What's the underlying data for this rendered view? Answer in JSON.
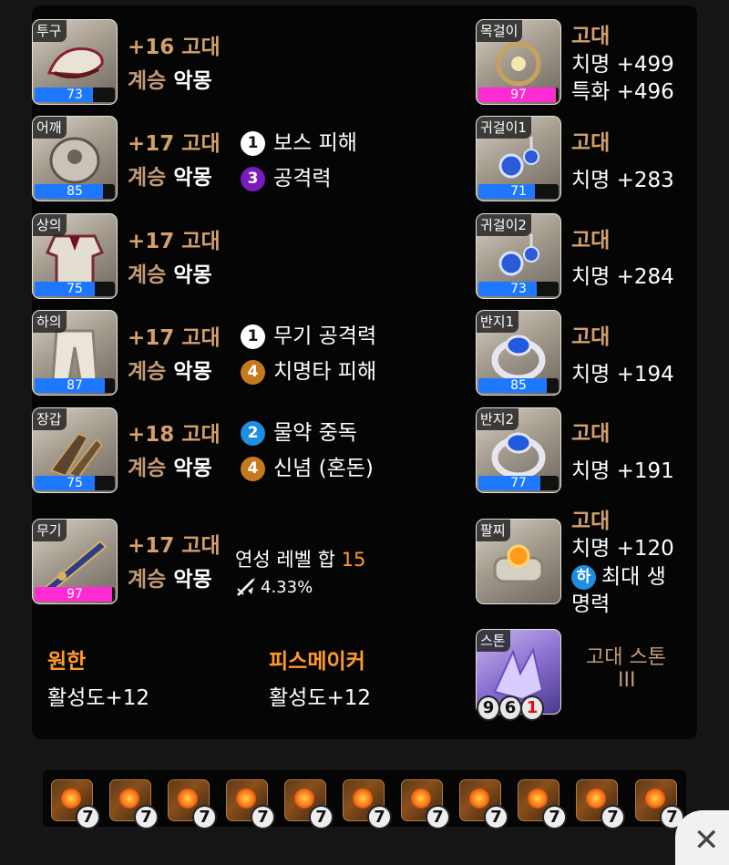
{
  "left_equipment": [
    {
      "slot": "투구",
      "quality": 73,
      "quality_color": "blue",
      "level": "+16",
      "grade": "고대",
      "succession": "계승",
      "set_name": "악몽"
    },
    {
      "slot": "어깨",
      "quality": 85,
      "quality_color": "blue",
      "level": "+17",
      "grade": "고대",
      "succession": "계승",
      "set_name": "악몽"
    },
    {
      "slot": "상의",
      "quality": 75,
      "quality_color": "blue",
      "level": "+17",
      "grade": "고대",
      "succession": "계승",
      "set_name": "악몽"
    },
    {
      "slot": "하의",
      "quality": 87,
      "quality_color": "blue",
      "level": "+17",
      "grade": "고대",
      "succession": "계승",
      "set_name": "악몽"
    },
    {
      "slot": "장갑",
      "quality": 75,
      "quality_color": "blue",
      "level": "+18",
      "grade": "고대",
      "succession": "계승",
      "set_name": "악몽"
    },
    {
      "slot": "무기",
      "quality": 97,
      "quality_color": "pink",
      "level": "+17",
      "grade": "고대",
      "succession": "계승",
      "set_name": "악몽"
    }
  ],
  "elixirs": [
    {
      "level": "1",
      "name": "보스 피해",
      "color": "white"
    },
    {
      "level": "3",
      "name": "공격력",
      "color": "purple"
    },
    {
      "level": "1",
      "name": "무기 공격력",
      "color": "white"
    },
    {
      "level": "4",
      "name": "치명타 피해",
      "color": "orange"
    },
    {
      "level": "2",
      "name": "물약 중독",
      "color": "blue"
    },
    {
      "level": "4",
      "name": "신념 (혼돈)",
      "color": "orange"
    }
  ],
  "transcend": {
    "label": "연성 레벨 합",
    "value": "15",
    "percent": "4.33%"
  },
  "accessories": [
    {
      "slot": "목걸이",
      "quality": 97,
      "quality_color": "pink",
      "grade": "고대",
      "stats": [
        "치명 +499",
        "특화 +496"
      ]
    },
    {
      "slot": "귀걸이1",
      "quality": 71,
      "quality_color": "blue",
      "grade": "고대",
      "stats": [
        "치명 +283"
      ]
    },
    {
      "slot": "귀걸이2",
      "quality": 73,
      "quality_color": "blue",
      "grade": "고대",
      "stats": [
        "치명 +284"
      ]
    },
    {
      "slot": "반지1",
      "quality": 85,
      "quality_color": "blue",
      "grade": "고대",
      "stats": [
        "치명 +194"
      ]
    },
    {
      "slot": "반지2",
      "quality": 77,
      "quality_color": "blue",
      "grade": "고대",
      "stats": [
        "치명 +191"
      ]
    },
    {
      "slot": "팔찌",
      "grade": "고대",
      "stats": [
        "치명 +120"
      ],
      "effect_badge": "하",
      "effect_text": "최대 생",
      "effect_text2": "명력"
    }
  ],
  "stone": {
    "slot": "스톤",
    "name_line1": "고대 스톤",
    "name_line2": "III",
    "n1": "9",
    "n2": "6",
    "n3": "1"
  },
  "engravings": [
    {
      "name": "원한",
      "value": "활성도+12"
    },
    {
      "name": "피스메이커",
      "value": "활성도+12"
    }
  ],
  "gems": [
    "7",
    "7",
    "7",
    "7",
    "7",
    "7",
    "7",
    "7",
    "7",
    "7",
    "7"
  ],
  "colors": {
    "blue_bar": "#1e78ff",
    "pink_bar": "#ff2bd2",
    "grade": "#d4a06a",
    "engraving": "#ff9a2a"
  },
  "close_icon": "close-icon"
}
